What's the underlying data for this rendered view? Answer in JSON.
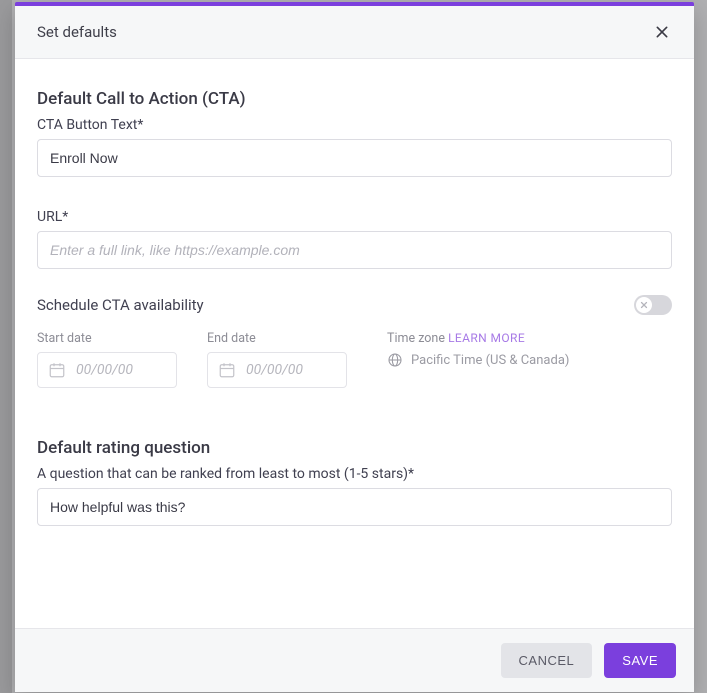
{
  "modal": {
    "title": "Set defaults",
    "cta": {
      "section_title": "Default Call to Action (CTA)",
      "button_text_label": "CTA Button Text*",
      "button_text_value": "Enroll Now",
      "url_label": "URL*",
      "url_value": "",
      "url_placeholder": "Enter a full link, like https://example.com"
    },
    "schedule": {
      "label": "Schedule CTA availability",
      "enabled": false,
      "start_label": "Start date",
      "end_label": "End date",
      "date_placeholder": "00/00/00",
      "timezone_label": "Time zone",
      "learn_more_label": "LEARN MORE",
      "timezone_value": "Pacific Time (US & Canada)"
    },
    "rating": {
      "section_title": "Default rating question",
      "sublabel": "A question that can be ranked from least to most (1-5 stars)*",
      "value": "How helpful was this?"
    },
    "footer": {
      "cancel": "CANCEL",
      "save": "SAVE"
    }
  }
}
